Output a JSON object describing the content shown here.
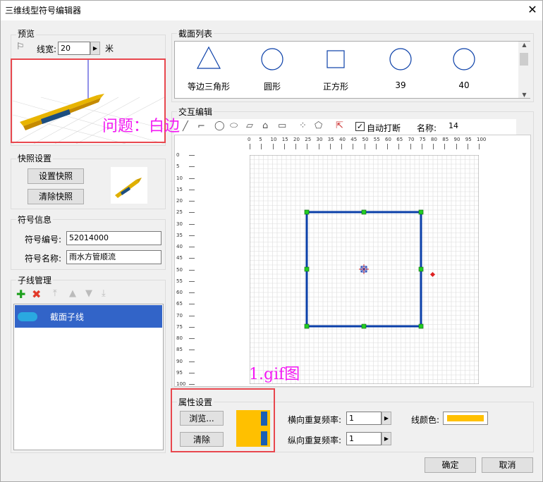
{
  "window": {
    "title": "三维线型符号编辑器"
  },
  "preview": {
    "label": "预览",
    "line_width_label": "线宽:",
    "line_width_value": "20",
    "unit": "米"
  },
  "snapshot": {
    "label": "快照设置",
    "set_button": "设置快照",
    "clear_button": "清除快照"
  },
  "symbol_info": {
    "label": "符号信息",
    "code_label": "符号编号:",
    "code_value": "52014000",
    "name_label": "符号名称:",
    "name_value": "雨水方管顺流"
  },
  "subline": {
    "label": "子线管理",
    "items": [
      {
        "label": "截面子线"
      }
    ]
  },
  "sections": {
    "label": "截面列表",
    "items": [
      {
        "label": "等边三角形"
      },
      {
        "label": "圆形"
      },
      {
        "label": "正方形"
      },
      {
        "label": "39"
      },
      {
        "label": "40"
      }
    ]
  },
  "interactive": {
    "label": "交互编辑",
    "auto_break_label": "自动打断",
    "name_label": "名称:",
    "name_value": "14",
    "ruler_ticks": [
      "0",
      "5",
      "10",
      "15",
      "20",
      "25",
      "30",
      "35",
      "40",
      "45",
      "50",
      "55",
      "60",
      "65",
      "70",
      "75",
      "80",
      "85",
      "90",
      "95",
      "100"
    ]
  },
  "attributes": {
    "label": "属性设置",
    "browse_button": "浏览...",
    "clear_button": "清除",
    "h_repeat_label": "横向重复频率:",
    "h_repeat_value": "1",
    "v_repeat_label": "纵向重复频率:",
    "v_repeat_value": "1",
    "line_color_label": "线颜色:",
    "line_color": "#ffc000"
  },
  "footer": {
    "ok_button": "确定",
    "cancel_button": "取消"
  },
  "annotations": {
    "question": "问题：白边",
    "gif_note": "1.gif图"
  },
  "colors": {
    "selection": "#3264c8",
    "annotation_box": "#e8474e",
    "annotation_text": "#f318f3",
    "shape_stroke": "#0a3fa8",
    "handle": "#22cc22"
  }
}
